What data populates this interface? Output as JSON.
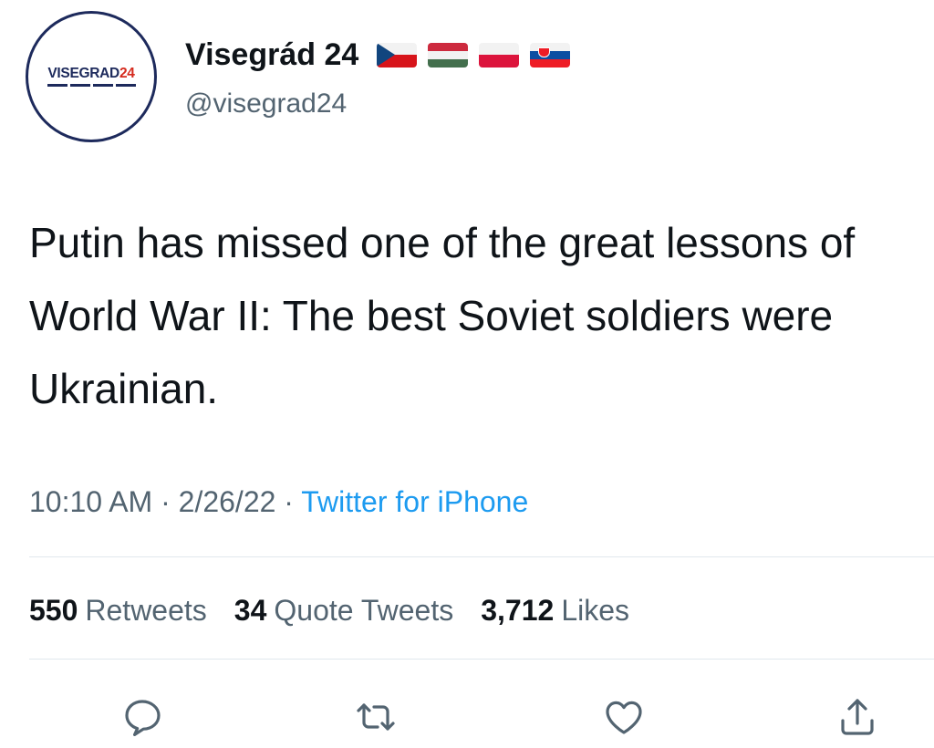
{
  "profile": {
    "avatar_logo_text": "VISEGRAD",
    "avatar_logo_number": "24",
    "display_name": "Visegrád 24",
    "handle": "@visegrad24",
    "flags": [
      "czech-flag",
      "hungary-flag",
      "poland-flag",
      "slovakia-flag"
    ]
  },
  "tweet": {
    "text": "Putin has missed one of the great lessons of World War II: The best Soviet soldiers were Ukrainian.",
    "time": "10:10 AM",
    "date": "2/26/22",
    "separator": " · ",
    "source": "Twitter for iPhone"
  },
  "stats": {
    "retweets_count": "550",
    "retweets_label": "Retweets",
    "quotes_count": "34",
    "quotes_label": "Quote Tweets",
    "likes_count": "3,712",
    "likes_label": "Likes"
  },
  "actions": {
    "icons": [
      "reply-icon",
      "retweet-icon",
      "like-icon",
      "share-icon"
    ]
  },
  "colors": {
    "text": "#0f1419",
    "secondary": "#536471",
    "link": "#1d9bf0",
    "divider": "#e1e8ed",
    "logo_navy": "#1d2a5c",
    "logo_red": "#d52b1e"
  }
}
